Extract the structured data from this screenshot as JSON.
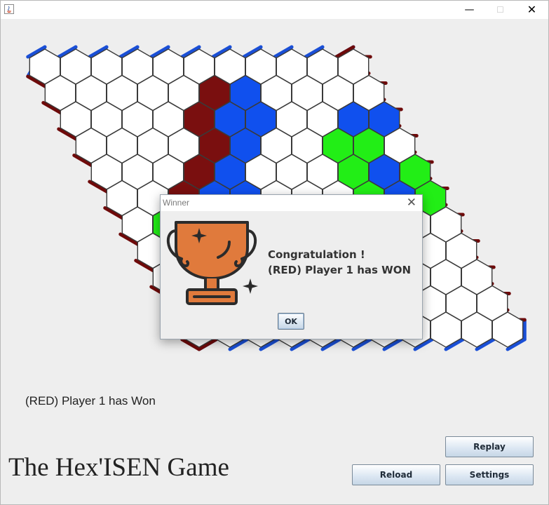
{
  "window": {
    "minimize_glyph": "—",
    "maximize_glyph": "☐",
    "close_glyph": "✕"
  },
  "board": {
    "size": 11,
    "border_color_red": "#6e0a0a",
    "border_color_blue": "#1a4fd6",
    "cell_colors": {
      "W": "#ffffff",
      "R": "#7a0f0f",
      "B": "#1050ee",
      "G": "#22ee16"
    },
    "rows": [
      "WWWWWWWWWWW",
      "WWWWWRBWWWW",
      "WWWWRBBWWBB",
      "WWWWRBWWGGW",
      "WWWRBWWWGBGG",
      "WWRBBWWWGBGB",
      "WGGWWWWWWWWW",
      "WWWWWWWWWWWW",
      "WWWWWWWWWWWW",
      "WWWWWWWWWWWW",
      "WWWWWWWWWWWW"
    ]
  },
  "status": {
    "text": "(RED) Player 1 has Won"
  },
  "title": {
    "text": "The Hex'ISEN Game"
  },
  "buttons": {
    "replay": "Replay",
    "reload": "Reload",
    "settings": "Settings"
  },
  "dialog": {
    "title": "Winner",
    "close_glyph": "✕",
    "line1": "Congratulation !",
    "line2": "(RED) Player 1 has WON",
    "ok": "OK",
    "trophy_icon": "trophy-icon",
    "trophy_color": "#e07a3c"
  }
}
